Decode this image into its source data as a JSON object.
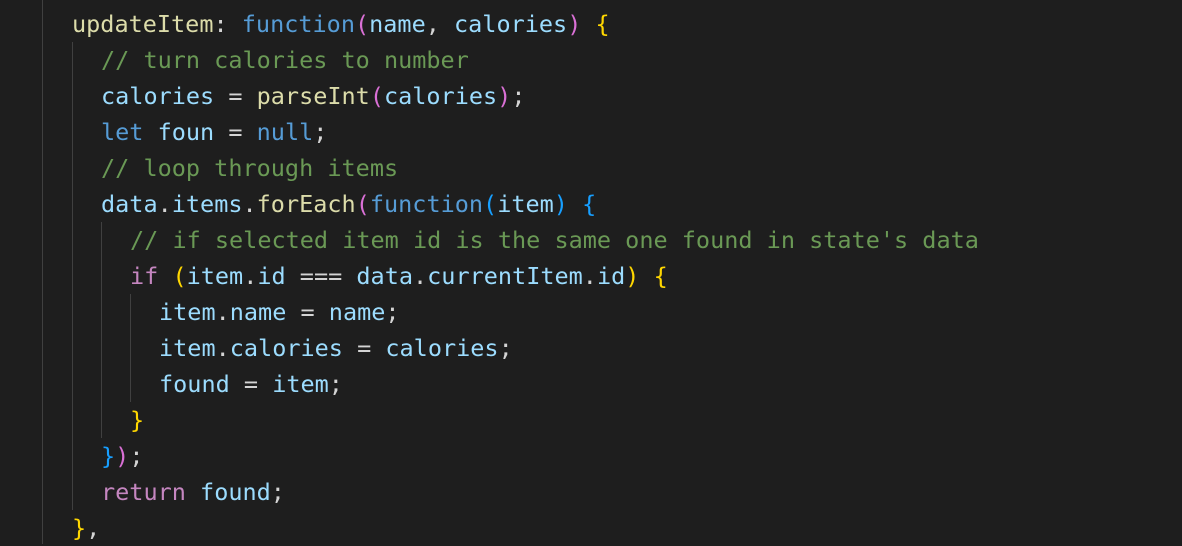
{
  "theme": {
    "background": "#1e1e1e",
    "indent_guide": "#404040",
    "colors": {
      "property": "#9cdcfe",
      "function": "#dcdcaa",
      "keyword": "#569cd6",
      "control": "#c586c0",
      "comment": "#6a9955",
      "bracket_1": "#ffd700",
      "bracket_2": "#da70d6",
      "bracket_3": "#179fff",
      "plain": "#d4d4d4"
    }
  },
  "code": {
    "lines": [
      {
        "indent": 1,
        "tokens": [
          {
            "t": "updateItem",
            "c": "t-fn"
          },
          {
            "t": ": ",
            "c": "t-plain"
          },
          {
            "t": "function",
            "c": "t-kw"
          },
          {
            "t": "(",
            "c": "t-brk2"
          },
          {
            "t": "name",
            "c": "t-prop"
          },
          {
            "t": ", ",
            "c": "t-plain"
          },
          {
            "t": "calories",
            "c": "t-prop"
          },
          {
            "t": ")",
            "c": "t-brk2"
          },
          {
            "t": " ",
            "c": "t-plain"
          },
          {
            "t": "{",
            "c": "t-brk1"
          }
        ]
      },
      {
        "indent": 2,
        "tokens": [
          {
            "t": "// turn calories to number",
            "c": "t-com"
          }
        ]
      },
      {
        "indent": 2,
        "tokens": [
          {
            "t": "calories",
            "c": "t-prop"
          },
          {
            "t": " = ",
            "c": "t-plain"
          },
          {
            "t": "parseInt",
            "c": "t-fn"
          },
          {
            "t": "(",
            "c": "t-brk2"
          },
          {
            "t": "calories",
            "c": "t-prop"
          },
          {
            "t": ")",
            "c": "t-brk2"
          },
          {
            "t": ";",
            "c": "t-plain"
          }
        ]
      },
      {
        "indent": 2,
        "tokens": [
          {
            "t": "let",
            "c": "t-kw"
          },
          {
            "t": " ",
            "c": "t-plain"
          },
          {
            "t": "foun",
            "c": "t-prop"
          },
          {
            "t": " = ",
            "c": "t-plain"
          },
          {
            "t": "null",
            "c": "t-kw"
          },
          {
            "t": ";",
            "c": "t-plain"
          }
        ]
      },
      {
        "indent": 2,
        "tokens": [
          {
            "t": "// loop through items",
            "c": "t-com"
          }
        ]
      },
      {
        "indent": 2,
        "tokens": [
          {
            "t": "data",
            "c": "t-prop"
          },
          {
            "t": ".",
            "c": "t-plain"
          },
          {
            "t": "items",
            "c": "t-prop"
          },
          {
            "t": ".",
            "c": "t-plain"
          },
          {
            "t": "forEach",
            "c": "t-fn"
          },
          {
            "t": "(",
            "c": "t-brk2"
          },
          {
            "t": "function",
            "c": "t-kw"
          },
          {
            "t": "(",
            "c": "t-brk3"
          },
          {
            "t": "item",
            "c": "t-prop"
          },
          {
            "t": ")",
            "c": "t-brk3"
          },
          {
            "t": " ",
            "c": "t-plain"
          },
          {
            "t": "{",
            "c": "t-brk3"
          }
        ]
      },
      {
        "indent": 3,
        "tokens": [
          {
            "t": "// if selected item id is the same one found in state's data",
            "c": "t-com"
          }
        ]
      },
      {
        "indent": 3,
        "tokens": [
          {
            "t": "if",
            "c": "t-ctrl"
          },
          {
            "t": " ",
            "c": "t-plain"
          },
          {
            "t": "(",
            "c": "t-brk1"
          },
          {
            "t": "item",
            "c": "t-prop"
          },
          {
            "t": ".",
            "c": "t-plain"
          },
          {
            "t": "id",
            "c": "t-prop"
          },
          {
            "t": " === ",
            "c": "t-plain"
          },
          {
            "t": "data",
            "c": "t-prop"
          },
          {
            "t": ".",
            "c": "t-plain"
          },
          {
            "t": "currentItem",
            "c": "t-prop"
          },
          {
            "t": ".",
            "c": "t-plain"
          },
          {
            "t": "id",
            "c": "t-prop"
          },
          {
            "t": ")",
            "c": "t-brk1"
          },
          {
            "t": " ",
            "c": "t-plain"
          },
          {
            "t": "{",
            "c": "t-brk1"
          }
        ]
      },
      {
        "indent": 4,
        "tokens": [
          {
            "t": "item",
            "c": "t-prop"
          },
          {
            "t": ".",
            "c": "t-plain"
          },
          {
            "t": "name",
            "c": "t-prop"
          },
          {
            "t": " = ",
            "c": "t-plain"
          },
          {
            "t": "name",
            "c": "t-prop"
          },
          {
            "t": ";",
            "c": "t-plain"
          }
        ]
      },
      {
        "indent": 4,
        "tokens": [
          {
            "t": "item",
            "c": "t-prop"
          },
          {
            "t": ".",
            "c": "t-plain"
          },
          {
            "t": "calories",
            "c": "t-prop"
          },
          {
            "t": " = ",
            "c": "t-plain"
          },
          {
            "t": "calories",
            "c": "t-prop"
          },
          {
            "t": ";",
            "c": "t-plain"
          }
        ]
      },
      {
        "indent": 4,
        "tokens": [
          {
            "t": "found",
            "c": "t-prop"
          },
          {
            "t": " = ",
            "c": "t-plain"
          },
          {
            "t": "item",
            "c": "t-prop"
          },
          {
            "t": ";",
            "c": "t-plain"
          }
        ]
      },
      {
        "indent": 3,
        "tokens": [
          {
            "t": "}",
            "c": "t-brk1"
          }
        ]
      },
      {
        "indent": 2,
        "tokens": [
          {
            "t": "}",
            "c": "t-brk3"
          },
          {
            "t": ")",
            "c": "t-brk2"
          },
          {
            "t": ";",
            "c": "t-plain"
          }
        ]
      },
      {
        "indent": 2,
        "tokens": [
          {
            "t": "return",
            "c": "t-ctrl"
          },
          {
            "t": " ",
            "c": "t-plain"
          },
          {
            "t": "found",
            "c": "t-prop"
          },
          {
            "t": ";",
            "c": "t-plain"
          }
        ]
      },
      {
        "indent": 1,
        "tokens": [
          {
            "t": "}",
            "c": "t-brk1"
          },
          {
            "t": ",",
            "c": "t-plain"
          }
        ]
      }
    ]
  }
}
